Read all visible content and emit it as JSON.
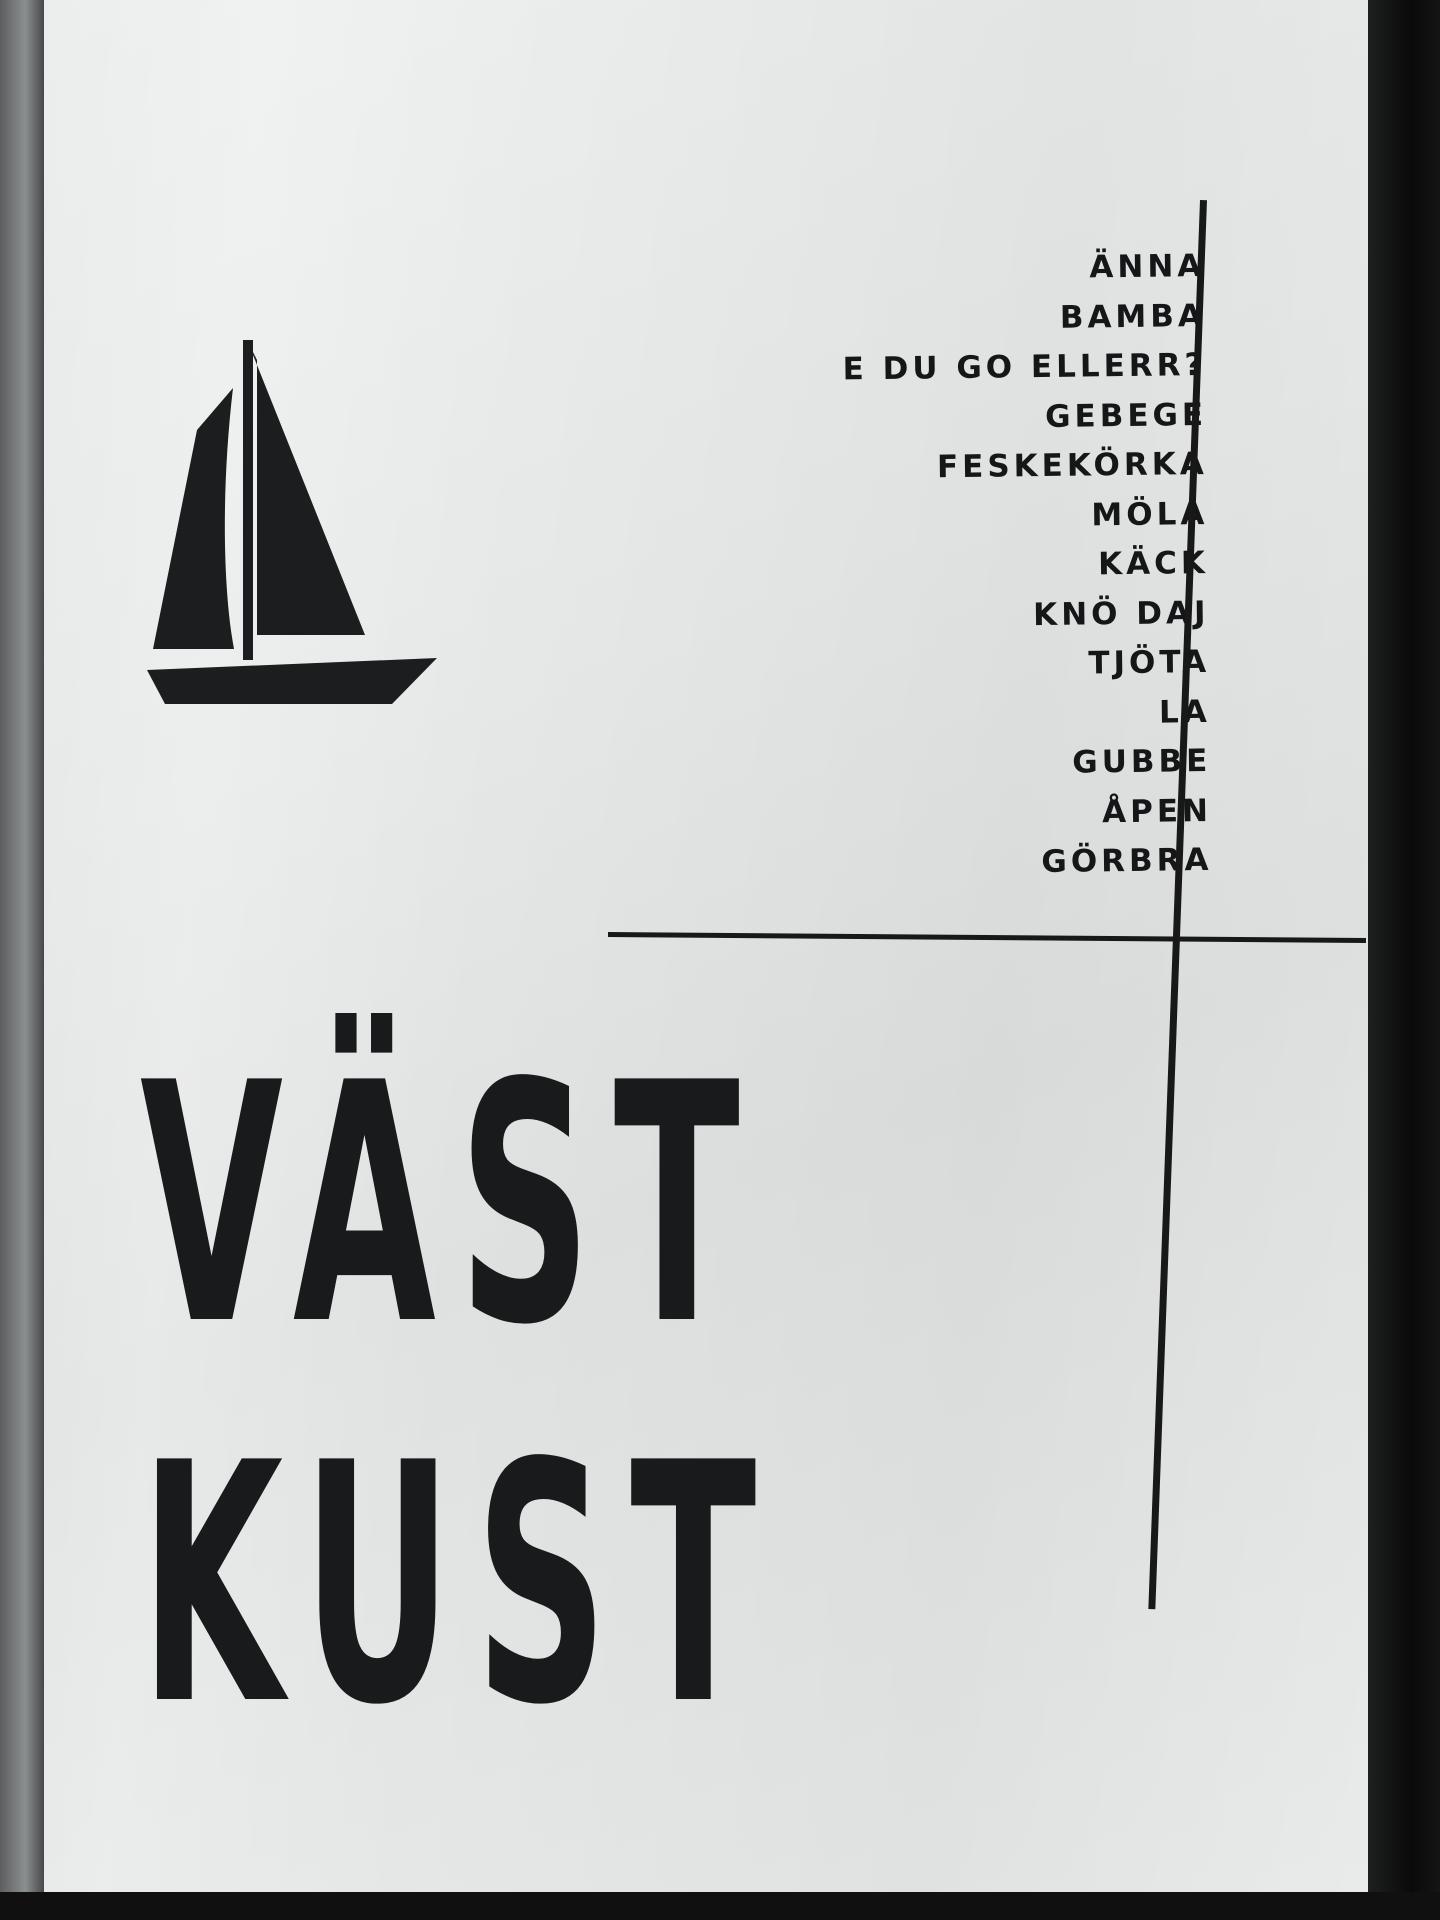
{
  "poster": {
    "words": [
      "ÄNNA",
      "BAMBA",
      "E DU GO ELLERR?",
      "GEBEGE",
      "FESKEKÖRKA",
      "MÖLA",
      "KÄCK",
      "KNÖ DAJ",
      "TJÖTA",
      "LA",
      "GUBBE",
      "ÅPEN",
      "GÖRBRA"
    ],
    "title_line_1": "VÄST",
    "title_line_2": "KUST",
    "icon": "sailboat-icon",
    "colors": {
      "ink": "#191a1b",
      "paper": "#e6e8e8",
      "frame": "#141414"
    }
  }
}
